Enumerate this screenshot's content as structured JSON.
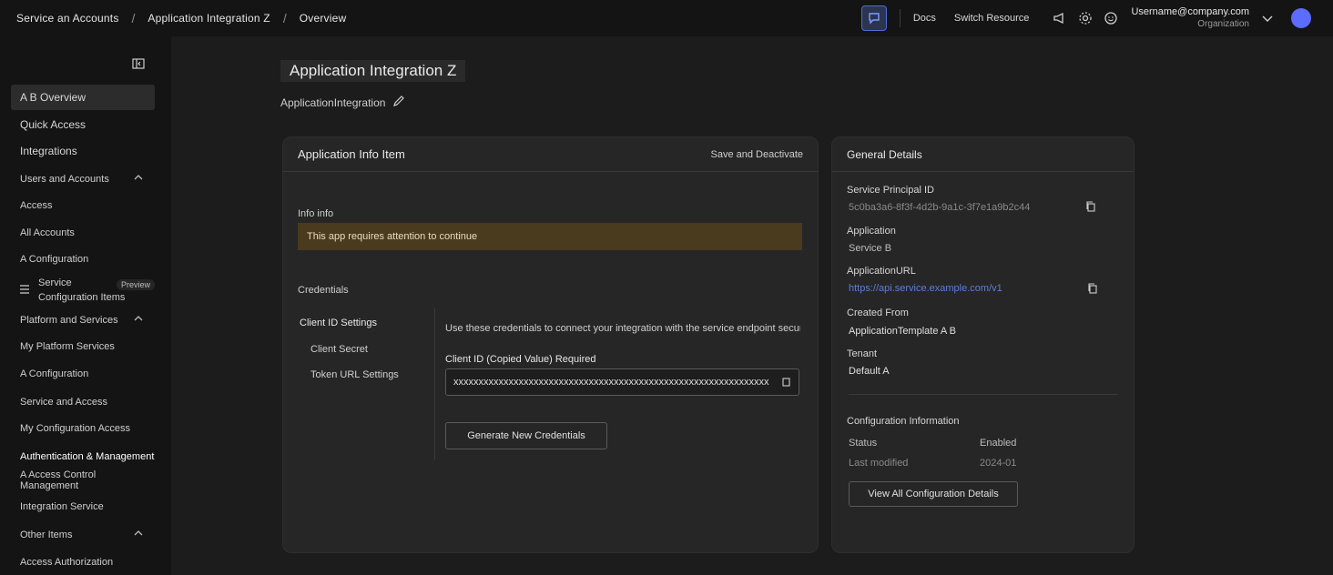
{
  "breadcrumb": {
    "items": [
      "Service an Accounts",
      "Application Integration Z",
      "Overview"
    ]
  },
  "topbar": {
    "links": [
      "Docs",
      "Switch Resource"
    ],
    "account_name": "Username@company.com",
    "account_org": "Organization"
  },
  "sidebar": {
    "active_item": "A B Overview",
    "items": {
      "overview": "A B Overview",
      "item_a": "Quick Access",
      "item_b": "Integrations",
      "group_a": "Users and Accounts",
      "sub_a": "Access",
      "sub_b": "All Accounts",
      "sub_c": "A Configuration",
      "sub_d_line1": "Service",
      "sub_d_line2": "Configuration Items",
      "sub_d_badge": "Preview",
      "group_b": "Platform and Services",
      "sub_e": "My Platform Services",
      "sub_f": "A Configuration",
      "sub_g": "Service and Access",
      "sub_h": "My Configuration Access",
      "sub_i": "Authentication & Management",
      "sub_j": "A Access Control Management",
      "sub_k": "Integration Service",
      "group_c": "Other Items",
      "sub_l": "Access Authorization"
    }
  },
  "page": {
    "title": "Application Integration Z",
    "subtitle": "ApplicationIntegration"
  },
  "main_card": {
    "title": "Application Info Item",
    "action": "Save and Deactivate",
    "status_label": "Info info",
    "warning": "This app requires attention to continue",
    "section_label": "Credentials",
    "tabs": [
      "Client ID Settings",
      "Client Secret",
      "Token URL Settings"
    ],
    "description": "Use these credentials to connect your integration with the service endpoint securely",
    "field_label": "Client ID (Copied Value) Required",
    "field_value": "xxxxxxxxxxxxxxxxxxxxxxxxxxxxxxxxxxxxxxxxxxxxxxxxxxxxxxxxxxxxxxx",
    "button": "Generate New Credentials"
  },
  "info_card": {
    "title": "General Details",
    "fields": [
      {
        "label": "Service Principal ID",
        "value": "5c0ba3a6-8f3f-4d2b-9a1c-3f7e1a9b2c44"
      },
      {
        "label": "Application",
        "value": "Service B"
      },
      {
        "label": "ApplicationURL",
        "value": "https://api.service.example.com/v1"
      },
      {
        "label": "Created From",
        "value": "ApplicationTemplate A B"
      },
      {
        "label": "Tenant",
        "value": "Default A"
      }
    ],
    "section": "Configuration Information",
    "rows": [
      {
        "key": "Status",
        "value": "Enabled"
      },
      {
        "key": "Last modified",
        "value": "2024-01"
      }
    ],
    "button": "View All Configuration Details"
  },
  "colors": {
    "accent": "#4f6bd8",
    "avatar": "#5b6cff",
    "warning_bg": "#4a3a1e",
    "link": "#5b7fd8"
  },
  "icons": [
    "collapse-sidebar-icon",
    "chat-icon",
    "megaphone-icon",
    "gear-icon",
    "smiley-icon",
    "chevron-down-icon",
    "edit-icon",
    "copy-icon",
    "list-icon"
  ]
}
